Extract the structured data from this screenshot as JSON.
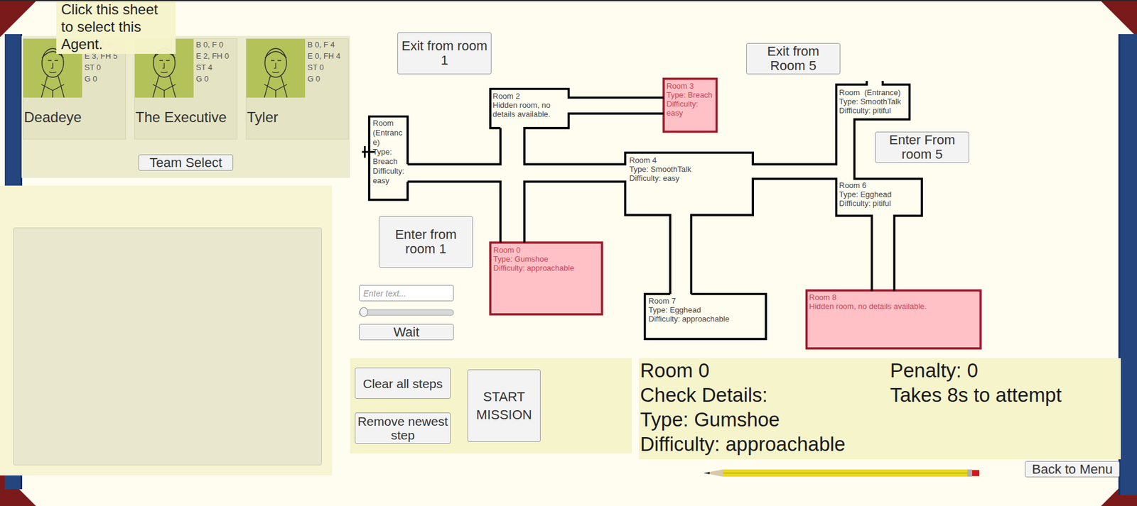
{
  "tooltip": "Click this sheet to select this Agent.",
  "agents": [
    {
      "name": "Deadeye",
      "stats": [
        "B 0, F 0",
        "E 3, FH 5",
        "ST 0",
        "G 0"
      ],
      "selected": false
    },
    {
      "name": "The Executive",
      "stats": [
        "B 0, F 0",
        "E 2, FH 0",
        "ST 4",
        "G 0"
      ],
      "selected": false
    },
    {
      "name": "Tyler",
      "stats": [
        "B 0, F 4",
        "E 0, FH 4",
        "ST 0",
        "G 0"
      ],
      "selected": false
    }
  ],
  "team_select": "Team Select",
  "map_buttons": {
    "exit_room_1": "Exit from room 1",
    "exit_room_5": "Exit from Room 5",
    "enter_room_5": "Enter From room 5",
    "enter_room_1": "Enter from room 1"
  },
  "rooms": [
    {
      "lines": [
        "Room (Entrance)",
        "Type: Breach",
        "Difficulty: easy"
      ],
      "highlighted": false
    },
    {
      "lines": [
        "Room 2",
        "Hidden room, no details available."
      ],
      "highlighted": false
    },
    {
      "lines": [
        "Room 3",
        "Type: Breach",
        "Difficulty: easy"
      ],
      "highlighted": true
    },
    {
      "lines": [
        "Room  (Entrance)",
        "Type: SmoothTalk",
        "Difficulty: pitiful"
      ],
      "highlighted": false
    },
    {
      "lines": [
        "Room 4",
        "Type: SmoothTalk",
        "Difficulty: easy"
      ],
      "highlighted": false
    },
    {
      "lines": [
        "Room 6",
        "Type: Egghead",
        "Difficulty: pitiful"
      ],
      "highlighted": false
    },
    {
      "lines": [
        "Room 0",
        "Type: Gumshoe",
        "Difficulty: approachable"
      ],
      "highlighted": true
    },
    {
      "lines": [
        "Room 7",
        "Type: Egghead",
        "Difficulty: approachable"
      ],
      "highlighted": false
    },
    {
      "lines": [
        "Room 8",
        "Hidden room, no details available."
      ],
      "highlighted": true
    }
  ],
  "controls": {
    "placeholder": "Enter text...",
    "level": 0,
    "wait": "Wait"
  },
  "actions": {
    "clear": "Clear all steps",
    "remove": "Remove newest step",
    "start": "START MISSION"
  },
  "details": {
    "lines": [
      "Room 0",
      "Check Details:",
      "Type: Gumshoe",
      "Difficulty: approachable"
    ],
    "penalty": "Penalty: 0",
    "time": "Takes 8s to attempt"
  },
  "back": "Back to Menu"
}
